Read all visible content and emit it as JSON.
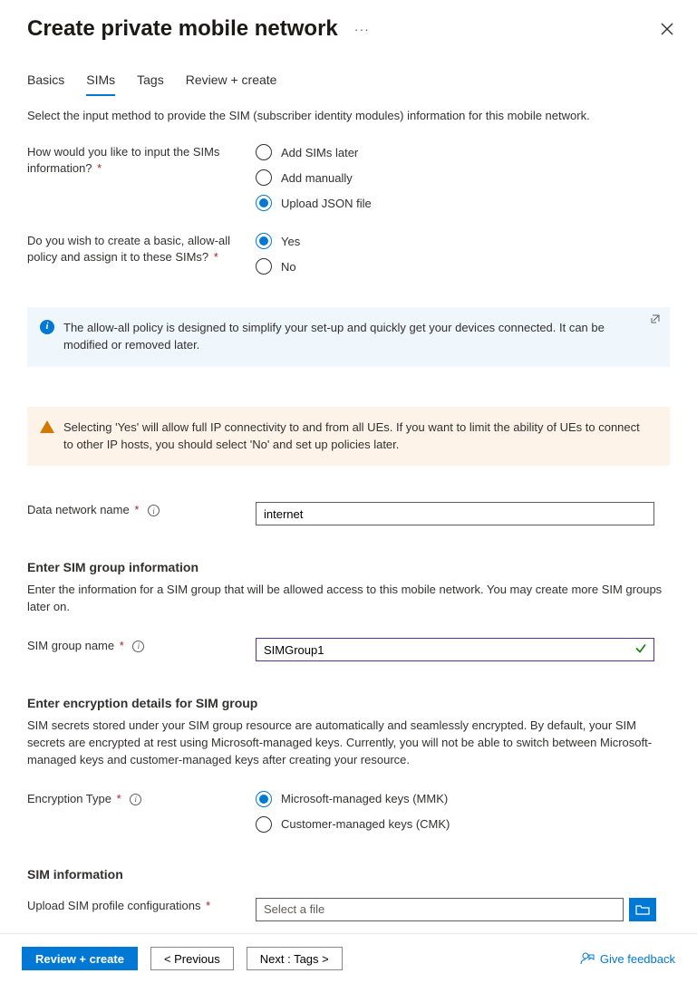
{
  "header": {
    "title": "Create private mobile network",
    "ellipsis": "···"
  },
  "tabs": {
    "basics": "Basics",
    "sims": "SIMs",
    "tags": "Tags",
    "review": "Review + create"
  },
  "intro": "Select the input method to provide the SIM (subscriber identity modules) information for this mobile network.",
  "inputMethod": {
    "label": "How would you like to input the SIMs information?",
    "options": {
      "later": "Add SIMs later",
      "manual": "Add manually",
      "upload": "Upload JSON file"
    },
    "selected": "upload"
  },
  "allowAll": {
    "label": "Do you wish to create a basic, allow-all policy and assign it to these SIMs?",
    "options": {
      "yes": "Yes",
      "no": "No"
    },
    "selected": "yes"
  },
  "infoBox": "The allow-all policy is designed to simplify your set-up and quickly get your devices connected. It can be modified or removed later.",
  "warnBox": "Selecting 'Yes' will allow full IP connectivity to and from all UEs. If you want to limit the ability of UEs to connect to other IP hosts, you should select 'No' and set up policies later.",
  "dataNetwork": {
    "label": "Data network name",
    "value": "internet"
  },
  "simGroupSection": {
    "heading": "Enter SIM group information",
    "desc": "Enter the information for a SIM group that will be allowed access to this mobile network. You may create more SIM groups later on.",
    "nameLabel": "SIM group name",
    "nameValue": "SIMGroup1"
  },
  "encryptionSection": {
    "heading": "Enter encryption details for SIM group",
    "desc": "SIM secrets stored under your SIM group resource are automatically and seamlessly encrypted. By default, your SIM secrets are encrypted at rest using Microsoft-managed keys. Currently, you will not be able to switch between Microsoft-managed keys and customer-managed keys after creating your resource.",
    "typeLabel": "Encryption Type",
    "options": {
      "mmk": "Microsoft-managed keys (MMK)",
      "cmk": "Customer-managed keys (CMK)"
    },
    "selected": "mmk"
  },
  "simInfoSection": {
    "heading": "SIM information",
    "uploadLabel": "Upload SIM profile configurations",
    "placeholder": "Select a file"
  },
  "footer": {
    "review": "Review + create",
    "previous": "< Previous",
    "next": "Next : Tags >",
    "feedback": "Give feedback"
  }
}
